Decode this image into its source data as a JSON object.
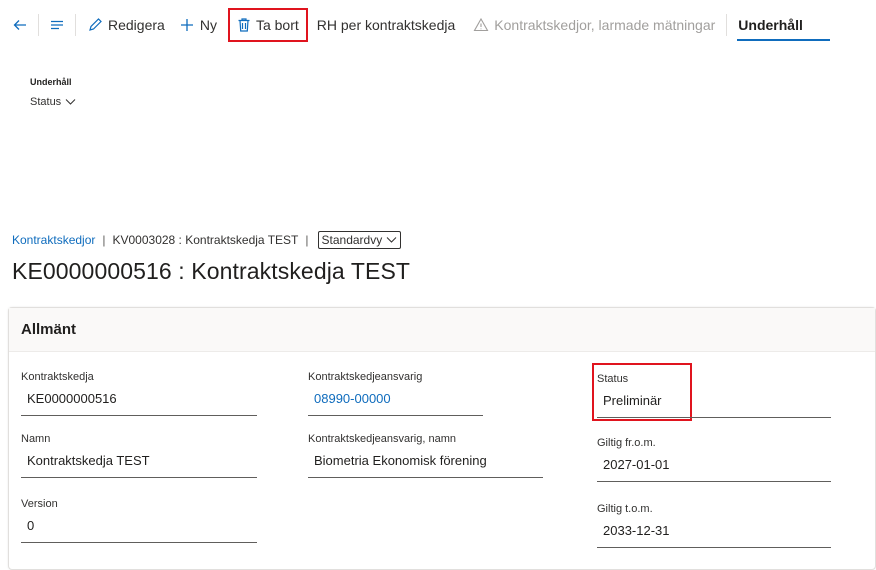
{
  "toolbar": {
    "redigera": "Redigera",
    "ny": "Ny",
    "ta_bort": "Ta bort",
    "rh_per_kontraktskedja": "RH per kontraktskedja",
    "kontraktskedjor_larmade": "Kontraktskedjor, larmade mätningar",
    "underhall_tab": "Underhåll"
  },
  "ribbon_group": {
    "title": "Underhåll",
    "status_dropdown": "Status"
  },
  "breadcrumb": {
    "link": "Kontraktskedjor",
    "record": "KV0003028 : Kontraktskedja TEST",
    "view": "Standardvy"
  },
  "page_title": "KE0000000516 : Kontraktskedja TEST",
  "section": {
    "title": "Allmänt",
    "fields": {
      "kontraktskedja": {
        "label": "Kontraktskedja",
        "value": "KE0000000516"
      },
      "namn": {
        "label": "Namn",
        "value": "Kontraktskedja TEST"
      },
      "version": {
        "label": "Version",
        "value": "0"
      },
      "ansvarig": {
        "label": "Kontraktskedjeansvarig",
        "value": "08990-00000"
      },
      "ansvarig_namn": {
        "label": "Kontraktskedjeansvarig, namn",
        "value": "Biometria Ekonomisk förening"
      },
      "status": {
        "label": "Status",
        "value": "Preliminär"
      },
      "giltig_from": {
        "label": "Giltig fr.o.m.",
        "value": "2027-01-01"
      },
      "giltig_tom": {
        "label": "Giltig t.o.m.",
        "value": "2033-12-31"
      }
    }
  },
  "colors": {
    "accent": "#0f6cbd",
    "highlight_red": "#e0141e",
    "text": "#323130"
  }
}
